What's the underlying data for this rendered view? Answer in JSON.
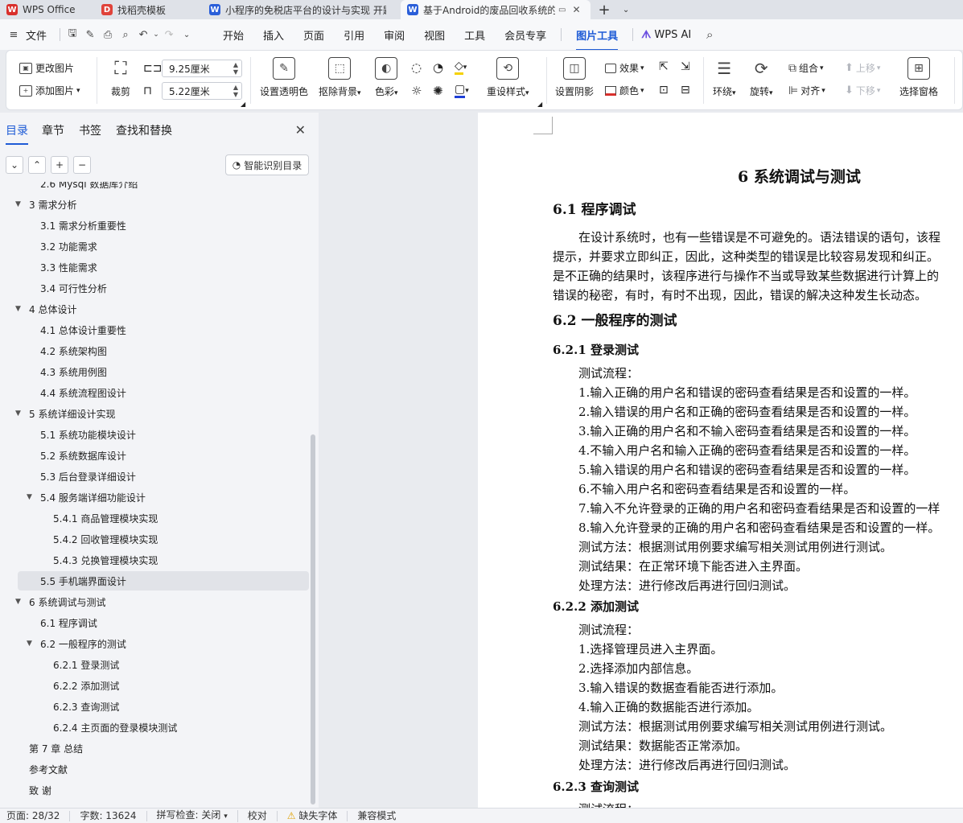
{
  "tabs": [
    {
      "label": "WPS Office",
      "icon": "wps-logo-icon",
      "color": "#d9302c"
    },
    {
      "label": "找稻壳模板",
      "icon": "docer-icon",
      "color": "#e0433a"
    },
    {
      "label": "小程序的免税店平台的设计与实现 开题",
      "icon": "word-doc-icon",
      "color": "#2b5fd9"
    },
    {
      "label": "基于Android的废品回收系统的",
      "icon": "word-doc-icon",
      "color": "#2b5fd9"
    }
  ],
  "menubar": {
    "file": "文件",
    "items": [
      "开始",
      "插入",
      "页面",
      "引用",
      "审阅",
      "视图",
      "工具",
      "会员专享"
    ],
    "active": "图片工具",
    "ai": "WPS AI"
  },
  "ribbon": {
    "change_picture": "更改图片",
    "add_picture": "添加图片",
    "crop": "裁剪",
    "width_value": "9.25厘米",
    "height_value": "5.22厘米",
    "set_transparent": "设置透明色",
    "remove_bg": "抠除背景",
    "color_mode": "色彩",
    "restyle": "重设样式",
    "shadow": "设置阴影",
    "effect": "效果",
    "color": "颜色",
    "wrap": "环绕",
    "rotate": "旋转",
    "group": "组合",
    "align": "对齐",
    "bring_forward": "上移",
    "send_backward": "下移",
    "selection_pane": "选择窗格"
  },
  "leftpanel": {
    "tabs": [
      "目录",
      "章节",
      "书签",
      "查找和替换"
    ],
    "smart_button": "智能识别目录",
    "toc": [
      {
        "label": "2.6 Mysql 数据库介绍",
        "level": 2
      },
      {
        "label": "3  需求分析",
        "level": 1,
        "expanded": true
      },
      {
        "label": "3.1  需求分析重要性",
        "level": 2
      },
      {
        "label": "3.2  功能需求",
        "level": 2
      },
      {
        "label": "3.3  性能需求",
        "level": 2
      },
      {
        "label": "3.4  可行性分析",
        "level": 2
      },
      {
        "label": "4  总体设计",
        "level": 1,
        "expanded": true
      },
      {
        "label": "4.1  总体设计重要性",
        "level": 2
      },
      {
        "label": "4.2  系统架构图",
        "level": 2
      },
      {
        "label": "4.3  系统用例图",
        "level": 2
      },
      {
        "label": "4.4  系统流程图设计",
        "level": 2
      },
      {
        "label": "5  系统详细设计实现",
        "level": 1,
        "expanded": true
      },
      {
        "label": "5.1  系统功能模块设计",
        "level": 2
      },
      {
        "label": "5.2  系统数据库设计",
        "level": 2
      },
      {
        "label": "5.3  后台登录详细设计",
        "level": 2
      },
      {
        "label": "5.4  服务端详细功能设计",
        "level": 2,
        "expanded": true
      },
      {
        "label": "5.4.1  商品管理模块实现",
        "level": 3
      },
      {
        "label": "5.4.2  回收管理模块实现",
        "level": 3
      },
      {
        "label": "5.4.3  兑换管理模块实现",
        "level": 3
      },
      {
        "label": "5.5  手机端界面设计",
        "level": 2,
        "selected": true
      },
      {
        "label": "6  系统调试与测试",
        "level": 1,
        "expanded": true
      },
      {
        "label": "6.1  程序调试",
        "level": 2
      },
      {
        "label": "6.2  一般程序的测试",
        "level": 2,
        "expanded": true
      },
      {
        "label": "6.2.1  登录测试",
        "level": 3
      },
      {
        "label": "6.2.2  添加测试",
        "level": 3
      },
      {
        "label": "6.2.3  查询测试",
        "level": 3
      },
      {
        "label": "6.2.4  主页面的登录模块测试",
        "level": 3
      },
      {
        "label": "第 7 章  总结",
        "level": 1
      },
      {
        "label": "参考文献",
        "level": 1
      },
      {
        "label": "致  谢",
        "level": 1
      }
    ]
  },
  "document": {
    "chapter_title": "6  系统调试与测试",
    "s61_title": "6.1  程序调试",
    "s61_para": [
      "在设计系统时，也有一些错误是不可避免的。语法错误的语句，该程",
      "提示，并要求立即纠正，因此，这种类型的错误是比较容易发现和纠正。",
      "是不正确的结果时，该程序进行与操作不当或导致某些数据进行计算上的",
      "错误的秘密，有时，有时不出现，因此，错误的解决这种发生长动态。"
    ],
    "s62_title": "6.2  一般程序的测试",
    "s621_title": "6.2.1  登录测试",
    "s621_lines": [
      "测试流程：",
      "1.输入正确的用户名和错误的密码查看结果是否和设置的一样。",
      "2.输入错误的用户名和正确的密码查看结果是否和设置的一样。",
      "3.输入正确的用户名和不输入密码查看结果是否和设置的一样。",
      "4.不输入用户名和输入正确的密码查看结果是否和设置的一样。",
      "5.输入错误的用户名和错误的密码查看结果是否和设置的一样。",
      "6.不输入用户名和密码查看结果是否和设置的一样。",
      "7.输入不允许登录的正确的用户名和密码查看结果是否和设置的一样",
      "8.输入允许登录的正确的用户名和密码查看结果是否和设置的一样。",
      "测试方法：根据测试用例要求编写相关测试用例进行测试。",
      "测试结果：在正常环境下能否进入主界面。",
      "处理方法：进行修改后再进行回归测试。"
    ],
    "s622_title": "6.2.2  添加测试",
    "s622_lines": [
      "测试流程：",
      "1.选择管理员进入主界面。",
      "2.选择添加内部信息。",
      "3.输入错误的数据查看能否进行添加。",
      "4.输入正确的数据能否进行添加。",
      "测试方法：根据测试用例要求编写相关测试用例进行测试。",
      "测试结果：数据能否正常添加。",
      "处理方法：进行修改后再进行回归测试。"
    ],
    "s623_title": "6.2.3  查询测试",
    "s623_partial": "测试流程："
  },
  "statusbar": {
    "page": "页面: 28/32",
    "words": "字数: 13624",
    "spell": "拼写检查: 关闭",
    "proof": "校对",
    "missing_font": "缺失字体",
    "compat": "兼容模式"
  }
}
